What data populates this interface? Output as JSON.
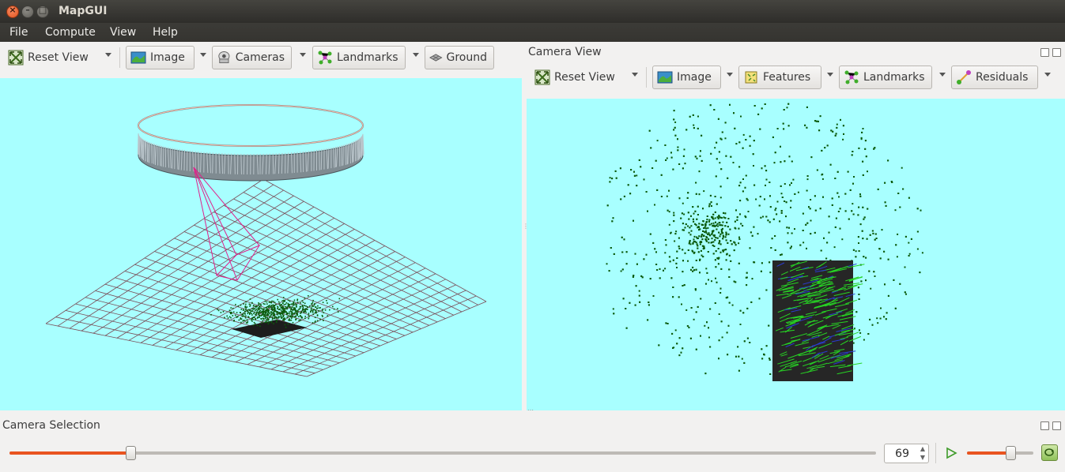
{
  "window": {
    "title": "MapGUI"
  },
  "menu": {
    "file": "File",
    "compute": "Compute",
    "view": "View",
    "help": "Help"
  },
  "world_toolbar": {
    "reset_view": "Reset View",
    "image": "Image",
    "cameras": "Cameras",
    "landmarks": "Landmarks",
    "ground": "Ground"
  },
  "camera_view": {
    "title": "Camera View",
    "toolbar": {
      "reset_view": "Reset View",
      "image": "Image",
      "features": "Features",
      "landmarks": "Landmarks",
      "residuals": "Residuals"
    }
  },
  "camera_selection": {
    "title": "Camera Selection",
    "frame_value": "69",
    "frame_slider_fraction": 0.14,
    "speed_slider_fraction": 0.65
  },
  "colors": {
    "viewport_bg": "#a8ffff",
    "accent": "#e95420",
    "landmark_green": "#0b5a0b",
    "camera_frustum": "#e0208a",
    "ground_grid": "#7a4a55"
  },
  "icons": {
    "reset": "reset-view-icon",
    "image": "image-icon",
    "cameras": "camera-icon",
    "landmarks": "landmarks-icon",
    "ground": "ground-icon",
    "features": "features-icon",
    "residuals": "residuals-icon",
    "play": "play-icon",
    "loop": "loop-icon"
  }
}
